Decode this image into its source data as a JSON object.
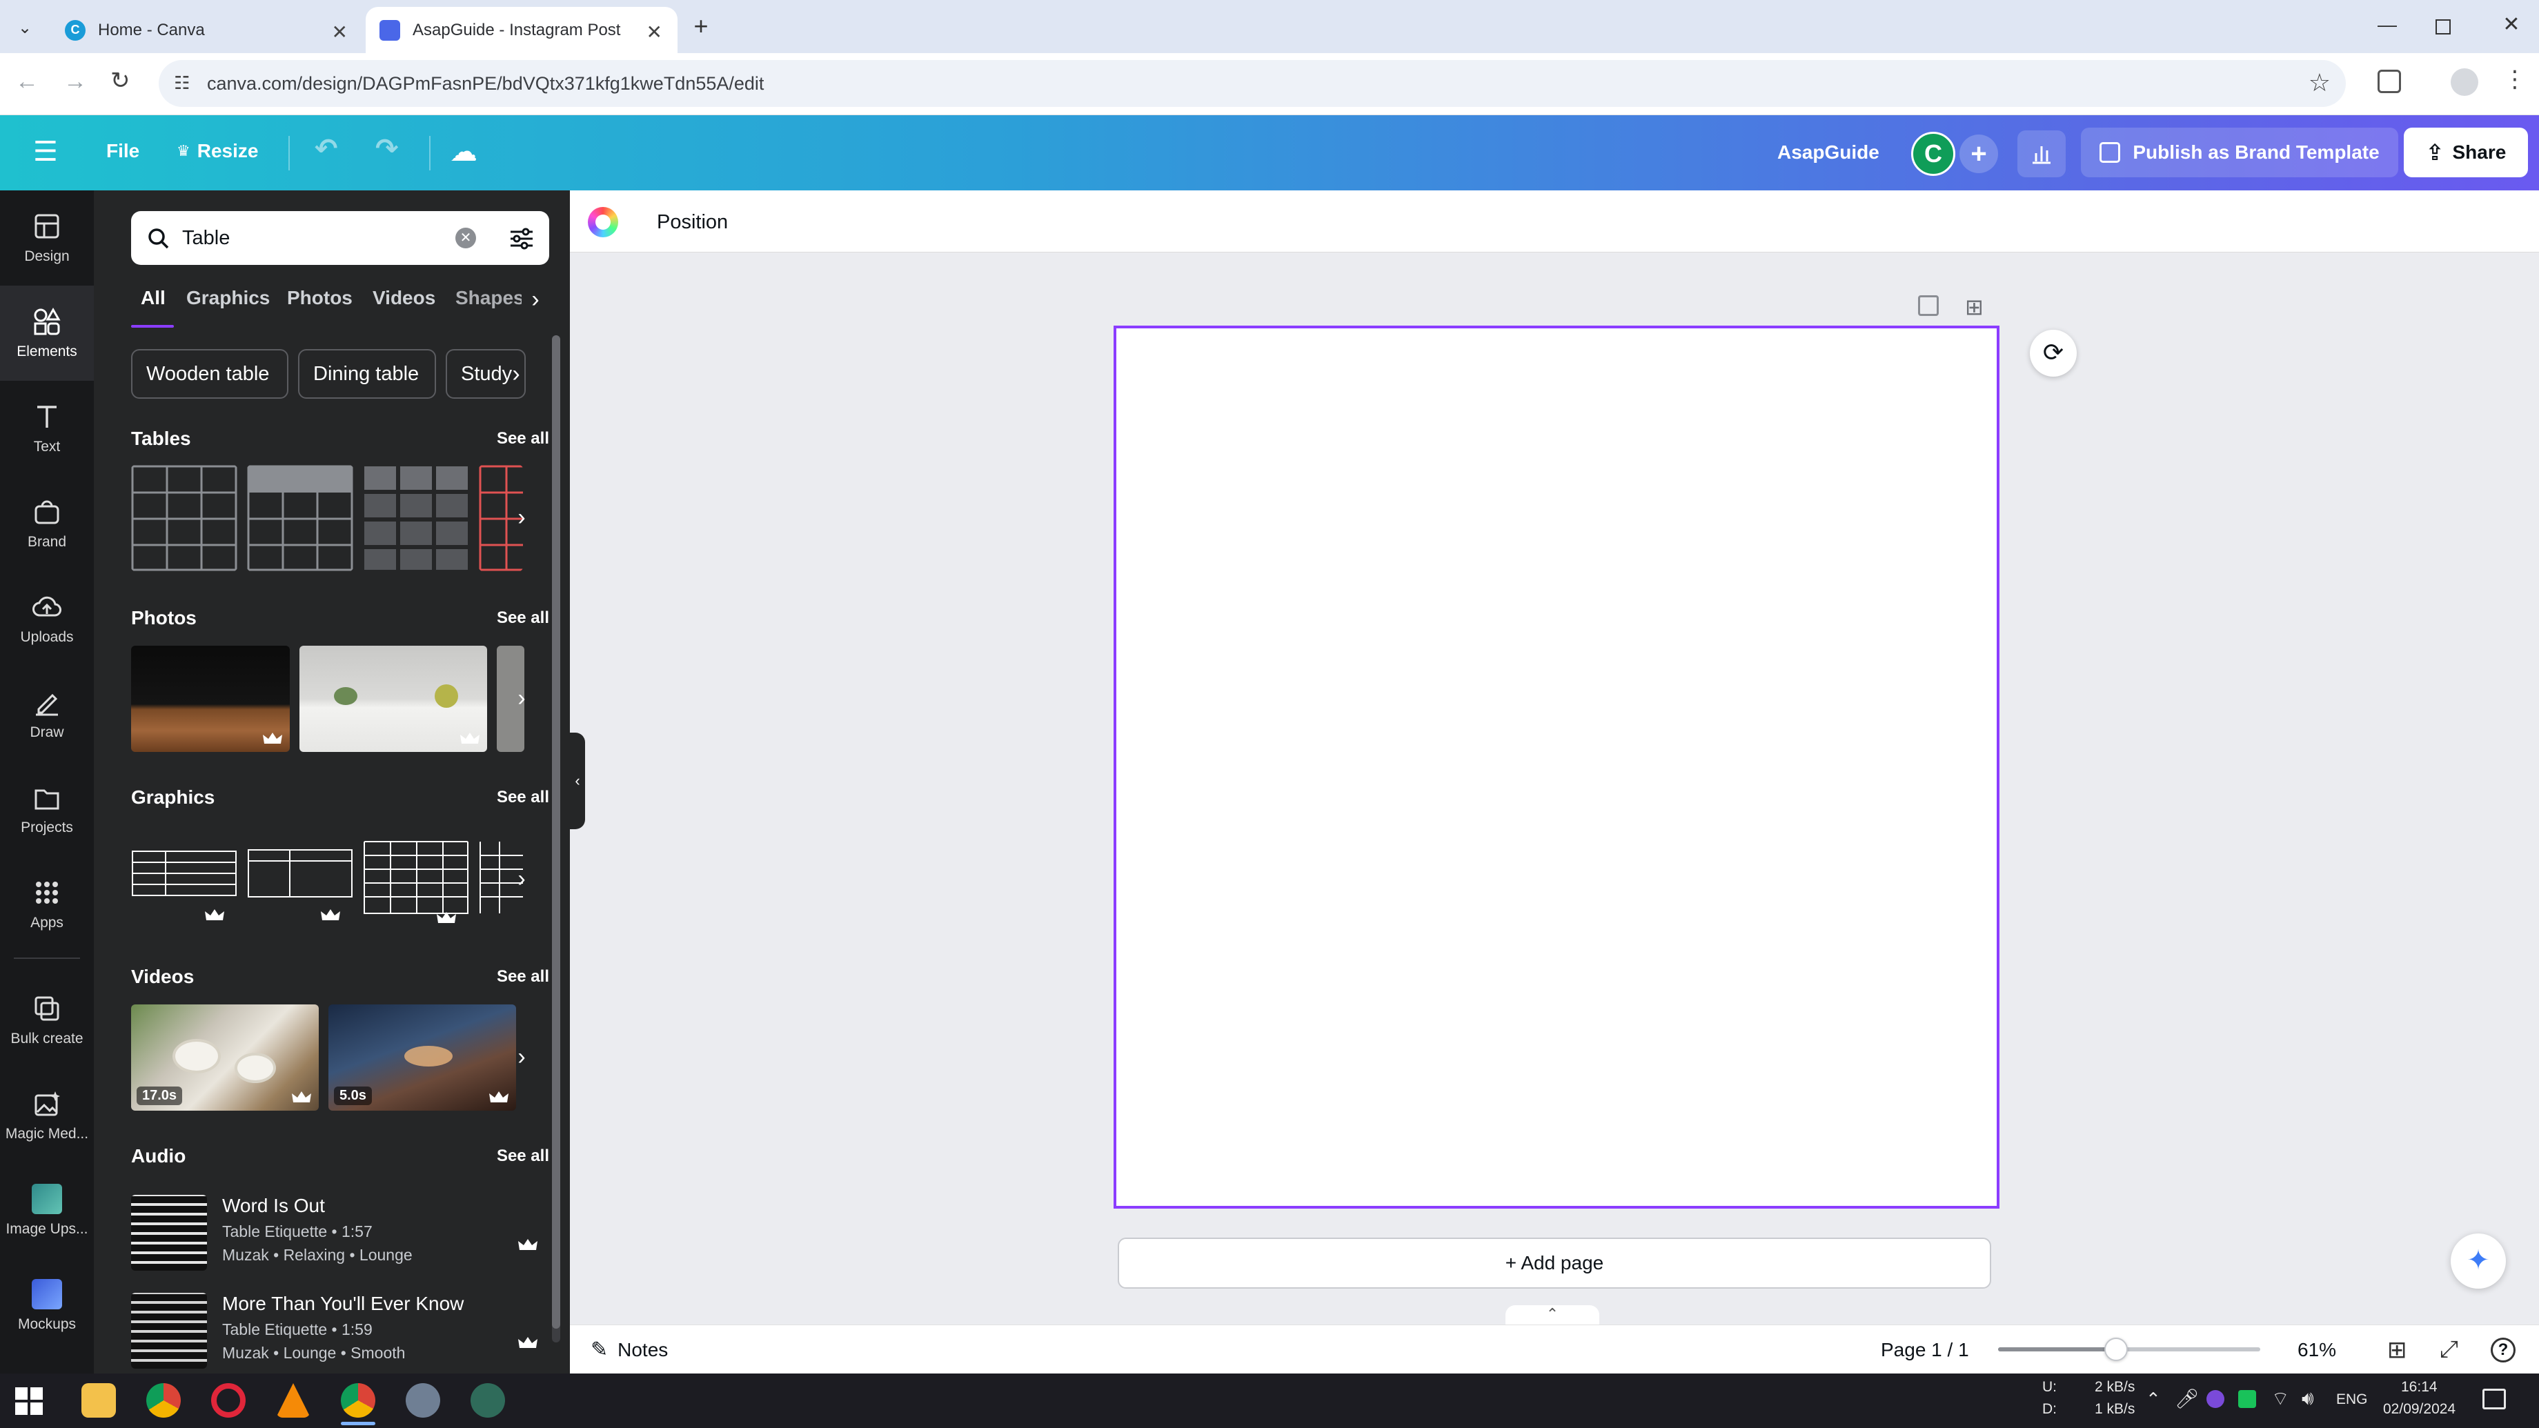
{
  "browser": {
    "tabs": [
      {
        "title": "Home - Canva"
      },
      {
        "title": "AsapGuide - Instagram Post"
      }
    ],
    "url": "canva.com/design/DAGPmFasnPE/bdVQtx371kfg1kweTdn55A/edit"
  },
  "header": {
    "file_label": "File",
    "resize_label": "Resize",
    "team_name": "AsapGuide",
    "avatar_letter": "C",
    "publish_label": "Publish as Brand Template",
    "share_label": "Share"
  },
  "rail": {
    "items": [
      {
        "label": "Design",
        "icon": "design-icon"
      },
      {
        "label": "Elements",
        "icon": "elements-icon"
      },
      {
        "label": "Text",
        "icon": "text-icon"
      },
      {
        "label": "Brand",
        "icon": "brand-icon"
      },
      {
        "label": "Uploads",
        "icon": "uploads-icon"
      },
      {
        "label": "Draw",
        "icon": "draw-icon"
      },
      {
        "label": "Projects",
        "icon": "projects-icon"
      },
      {
        "label": "Apps",
        "icon": "apps-icon"
      },
      {
        "label": "Bulk create",
        "icon": "bulk-create-icon"
      },
      {
        "label": "Magic Med...",
        "icon": "magic-media-icon"
      },
      {
        "label": "Image Ups...",
        "icon": "image-upscaler-icon"
      },
      {
        "label": "Mockups",
        "icon": "mockups-icon"
      }
    ]
  },
  "panel": {
    "search_value": "Table",
    "filter_tabs": [
      "All",
      "Graphics",
      "Photos",
      "Videos",
      "Shapes"
    ],
    "chips": [
      "Wooden table",
      "Dining table",
      "Study"
    ],
    "see_all": "See all",
    "sections": {
      "tables": "Tables",
      "photos": "Photos",
      "graphics": "Graphics",
      "videos": "Videos",
      "audio": "Audio"
    },
    "videos": [
      {
        "duration": "17.0s"
      },
      {
        "duration": "5.0s"
      }
    ],
    "audio": [
      {
        "title": "Word Is Out",
        "meta": "Table Etiquette • 1:57",
        "tags": "Muzak • Relaxing • Lounge"
      },
      {
        "title": "More Than You'll Ever Know",
        "meta": "Table Etiquette • 1:59",
        "tags": "Muzak • Lounge • Smooth"
      }
    ]
  },
  "editor": {
    "position_label": "Position",
    "add_page_label": "+ Add page",
    "notes_label": "Notes",
    "page_indicator": "Page 1 / 1",
    "zoom": "61%",
    "zoom_fraction": 0.45
  },
  "taskbar": {
    "net_up_label": "U:",
    "net_down_label": "D:",
    "net_up": "2 kB/s",
    "net_down": "1 kB/s",
    "lang": "ENG",
    "time": "16:14",
    "date": "02/09/2024"
  },
  "colors": {
    "accent": "#8b3dff",
    "header_start": "#1fc0cf",
    "header_end": "#6a5af0"
  }
}
